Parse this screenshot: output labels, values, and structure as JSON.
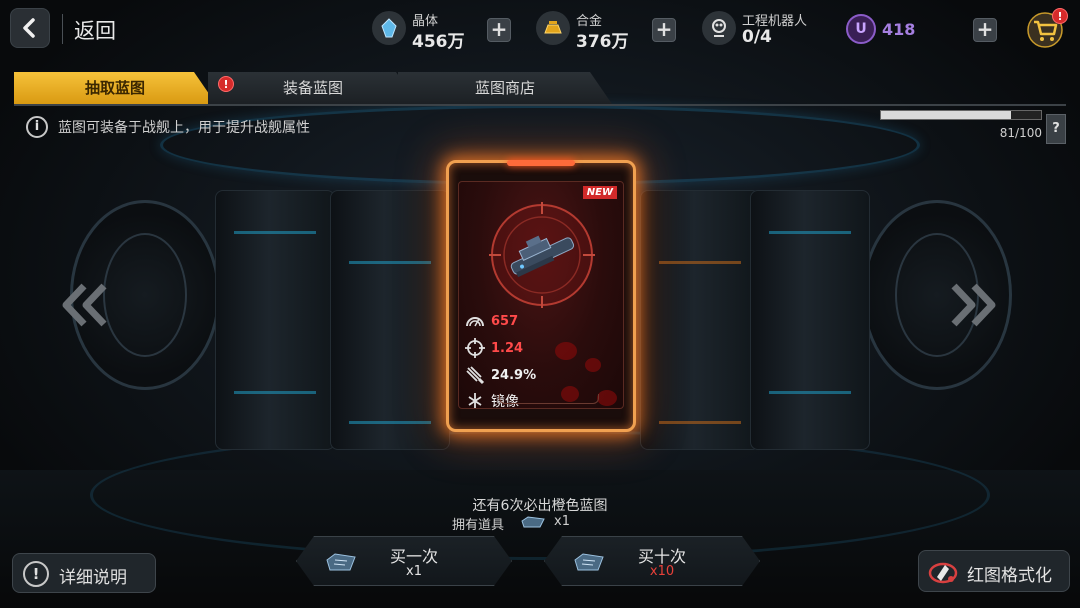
{
  "header": {
    "back_label": "返回",
    "resources": [
      {
        "name": "晶体",
        "value": "456万",
        "icon": "crystal-icon"
      },
      {
        "name": "合金",
        "value": "376万",
        "icon": "alloy-icon"
      },
      {
        "name": "工程机器人",
        "value": "0/4",
        "icon": "robot-icon"
      }
    ],
    "premium": {
      "symbol": "U",
      "value": "418"
    },
    "plus_label": "+",
    "shop_badge": "!"
  },
  "tabs": [
    {
      "label": "抽取蓝图",
      "active": true
    },
    {
      "label": "装备蓝图",
      "active": false,
      "badge": "!"
    },
    {
      "label": "蓝图商店",
      "active": false
    }
  ],
  "info": {
    "icon_text": "i",
    "text": "蓝图可装备于战舰上，用于提升战舰属性",
    "progress": {
      "current": 81,
      "max": 100,
      "text": "81/100"
    },
    "help": "?"
  },
  "card": {
    "new_tag": "NEW",
    "rarity_color": "#f0a050",
    "stats": [
      {
        "icon": "damage-gauge-icon",
        "value": "657",
        "color": "red"
      },
      {
        "icon": "crosshair-icon",
        "value": "1.24",
        "color": "red"
      },
      {
        "icon": "missile-icon",
        "value": "24.9%",
        "color": "white"
      },
      {
        "icon": "mirror-skill-icon",
        "value": "镜像",
        "color": "white"
      }
    ]
  },
  "bottom": {
    "guarantee_text": "还有6次必出橙色蓝图",
    "own_label": "拥有道具",
    "own_count": "x1",
    "detail_icon": "!",
    "detail_label": "详细说明",
    "buy_once": {
      "label": "买一次",
      "count": "x1",
      "count_color": "#e4e4e4"
    },
    "buy_ten": {
      "label": "买十次",
      "count": "x10",
      "count_color": "#e8413a"
    },
    "format_label": "红图格式化"
  }
}
